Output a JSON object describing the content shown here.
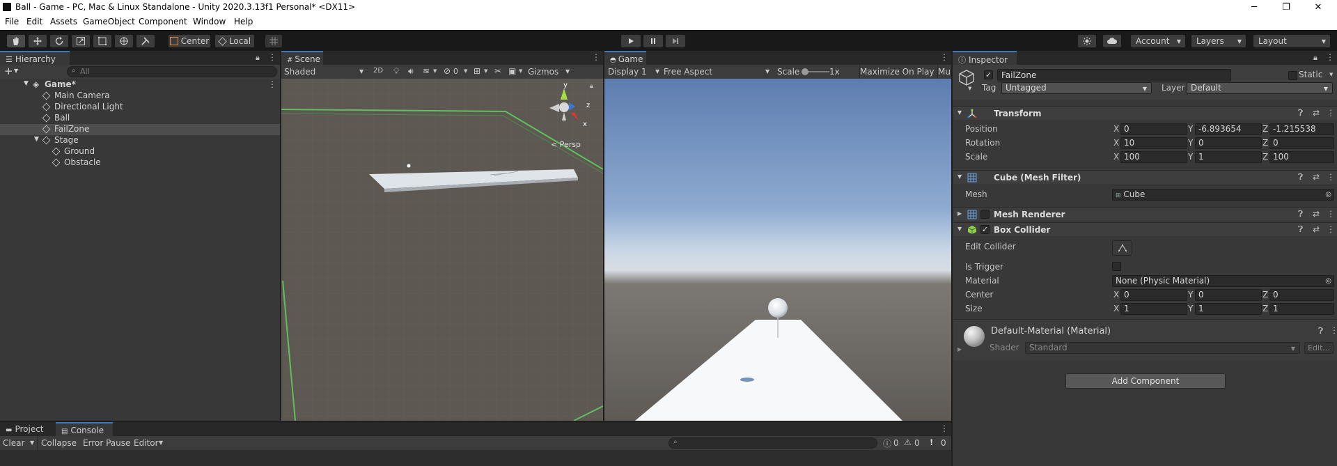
{
  "window": {
    "title": "Ball - Game - PC, Mac & Linux Standalone - Unity 2020.3.13f1 Personal* <DX11>",
    "minimize": "─",
    "maximize": "❐",
    "close": "✕"
  },
  "menu": [
    "File",
    "Edit",
    "Assets",
    "GameObject",
    "Component",
    "Window",
    "Help"
  ],
  "toolbar": {
    "pivot_mode": "Center",
    "pivot_space": "Local",
    "account": "Account",
    "layers": "Layers",
    "layout": "Layout"
  },
  "hierarchy": {
    "tab": "Hierarchy",
    "add_button": "+",
    "search_placeholder": "All",
    "scene_name": "Game*",
    "items": [
      {
        "label": "Main Camera",
        "depth": 1
      },
      {
        "label": "Directional Light",
        "depth": 1
      },
      {
        "label": "Ball",
        "depth": 1
      },
      {
        "label": "FailZone",
        "depth": 1,
        "selected": true
      },
      {
        "label": "Stage",
        "depth": 1,
        "expanded": true
      },
      {
        "label": "Ground",
        "depth": 2
      },
      {
        "label": "Obstacle",
        "depth": 2
      }
    ]
  },
  "scene": {
    "tab": "Scene",
    "shading": "Shaded",
    "mode_2d": "2D",
    "hidden_count": "0",
    "gizmos": "Gizmos",
    "persp_label": "< Persp",
    "axis_x": "x",
    "axis_y": "y",
    "axis_z": "z"
  },
  "game": {
    "tab": "Game",
    "display": "Display 1",
    "aspect": "Free Aspect",
    "scale_label": "Scale",
    "scale_value": "1x",
    "maximize_on_play": "Maximize On Play",
    "more": "Mu"
  },
  "inspector": {
    "tab": "Inspector",
    "object_name": "FailZone",
    "static_label": "Static",
    "tag_label": "Tag",
    "tag_value": "Untagged",
    "layer_label": "Layer",
    "layer_value": "Default",
    "transform": {
      "title": "Transform",
      "position_label": "Position",
      "rotation_label": "Rotation",
      "scale_label": "Scale",
      "position": {
        "x": "0",
        "y": "-6.893654",
        "z": "-1.215538"
      },
      "rotation": {
        "x": "10",
        "y": "0",
        "z": "0"
      },
      "scale": {
        "x": "100",
        "y": "1",
        "z": "100"
      }
    },
    "mesh_filter": {
      "title": "Cube (Mesh Filter)",
      "mesh_label": "Mesh",
      "mesh_value": "Cube"
    },
    "mesh_renderer": {
      "title": "Mesh Renderer",
      "enabled": false
    },
    "box_collider": {
      "title": "Box Collider",
      "enabled": true,
      "edit_collider_label": "Edit Collider",
      "is_trigger_label": "Is Trigger",
      "is_trigger": false,
      "material_label": "Material",
      "material_value": "None (Physic Material)",
      "center_label": "Center",
      "center": {
        "x": "0",
        "y": "0",
        "z": "0"
      },
      "size_label": "Size",
      "size": {
        "x": "1",
        "y": "1",
        "z": "1"
      }
    },
    "material": {
      "title": "Default-Material (Material)",
      "shader_label": "Shader",
      "shader_value": "Standard",
      "edit_button": "Edit..."
    },
    "add_component": "Add Component"
  },
  "bottom": {
    "tab_project": "Project",
    "tab_console": "Console",
    "clear": "Clear",
    "collapse": "Collapse",
    "error_pause": "Error Pause",
    "editor": "Editor",
    "log_count": "0",
    "warn_count": "0",
    "error_count": "0"
  },
  "xyz": {
    "x": "X",
    "y": "Y",
    "z": "Z"
  },
  "colors": {
    "accent_tab": "#3a79bb",
    "panel": "#383838",
    "toolbar": "#191919",
    "selected_row": "#4d4d4d"
  }
}
